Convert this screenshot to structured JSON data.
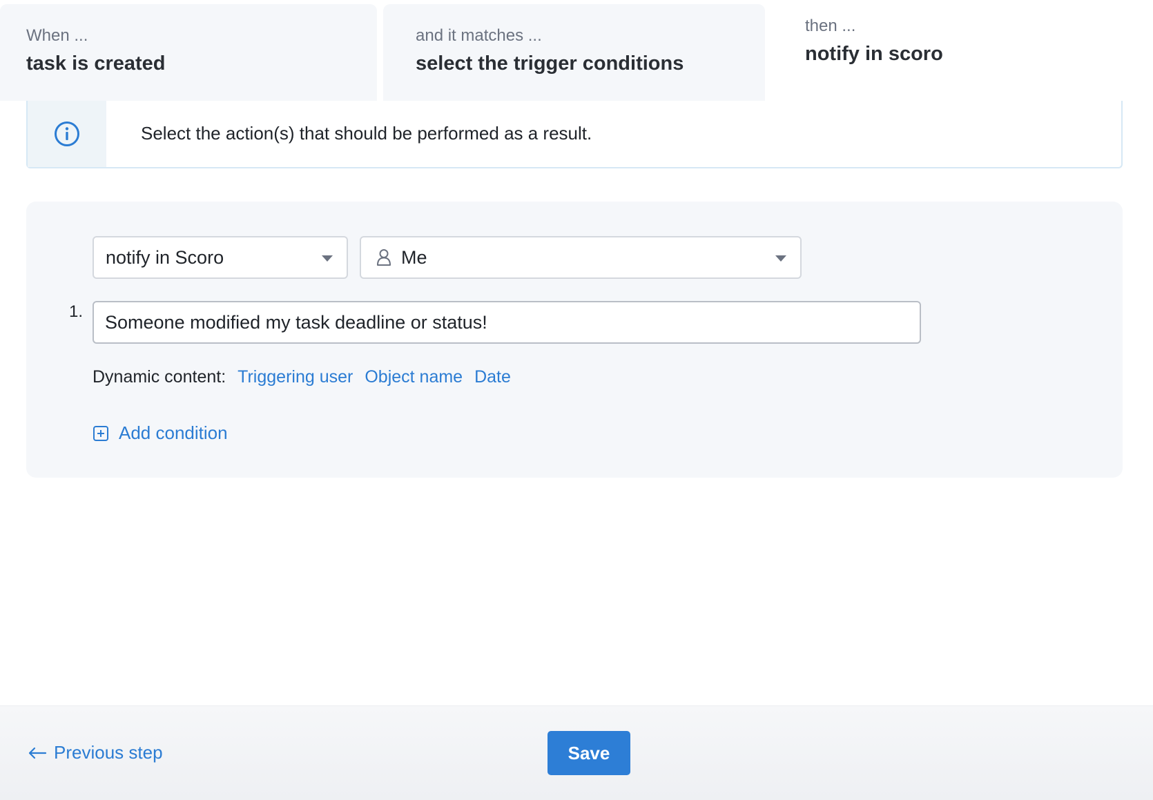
{
  "steps": [
    {
      "sub": "When ...",
      "main": "task is created"
    },
    {
      "sub": "and it matches ...",
      "main": "select the trigger conditions"
    },
    {
      "sub": "then ...",
      "main": "notify in scoro"
    }
  ],
  "info": {
    "text": "Select the action(s) that should be performed as a result.",
    "icon": "info-icon",
    "accent": "#2b7cd3"
  },
  "action": {
    "type_select": "notify in Scoro",
    "recipient_select": "Me",
    "recipient_icon": "user-icon",
    "row_number": "1.",
    "message_value": "Someone modified my task deadline or status!",
    "dynamic_label": "Dynamic content:",
    "dynamic_links": [
      "Triggering user",
      "Object name",
      "Date"
    ],
    "add_condition": "Add condition"
  },
  "footer": {
    "previous_label": "Previous step",
    "save_label": "Save"
  },
  "colors": {
    "link": "#2b7cd3",
    "primary_button": "#2d7ed6",
    "panel_bg": "#f5f7fa"
  }
}
